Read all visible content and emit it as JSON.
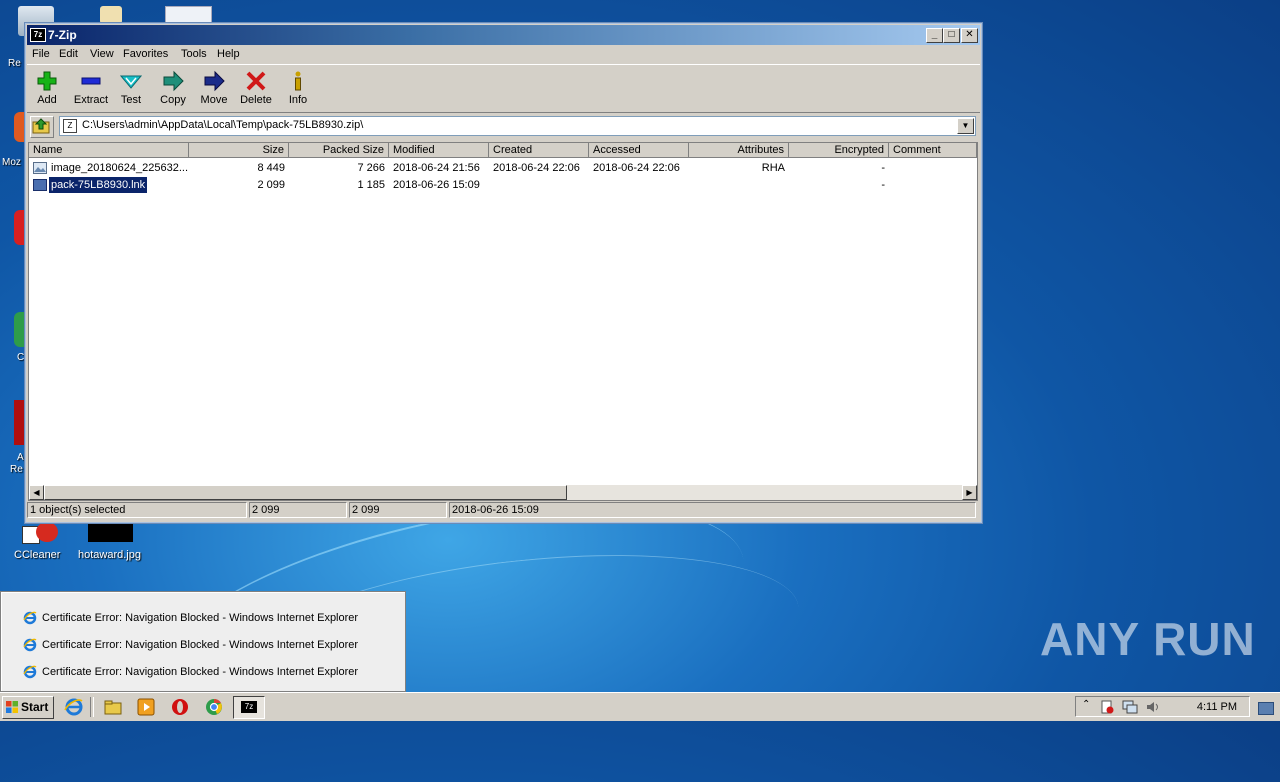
{
  "desktop": {
    "icons": [
      {
        "label": "CCleaner"
      },
      {
        "label": "hotaward.jpg"
      }
    ],
    "partial_labels": [
      "Re",
      "Moz",
      "C",
      "A",
      "Re"
    ]
  },
  "window": {
    "title": "7-Zip",
    "app_icon": "7z",
    "menu": [
      "File",
      "Edit",
      "View",
      "Favorites",
      "Tools",
      "Help"
    ],
    "toolbar": [
      {
        "label": "Add",
        "icon": "plus-icon",
        "color": "#17b317"
      },
      {
        "label": "Extract",
        "icon": "minus-icon",
        "color": "#1e2bd6"
      },
      {
        "label": "Test",
        "icon": "check-icon",
        "color": "#18c0c8"
      },
      {
        "label": "Copy",
        "icon": "arrow-right-icon",
        "color": "#1e8f7a"
      },
      {
        "label": "Move",
        "icon": "arrow-right-icon",
        "color": "#1a2b8a"
      },
      {
        "label": "Delete",
        "icon": "x-icon",
        "color": "#d01818"
      },
      {
        "label": "Info",
        "icon": "info-icon",
        "color": "#c8a000"
      }
    ],
    "address": "C:\\Users\\admin\\AppData\\Local\\Temp\\pack-75LB8930.zip\\",
    "columns": [
      "Name",
      "Size",
      "Packed Size",
      "Modified",
      "Created",
      "Accessed",
      "Attributes",
      "Encrypted",
      "Comment"
    ],
    "rows": [
      {
        "name": "image_20180624_225632...",
        "size": "8 449",
        "packed": "7 266",
        "modified": "2018-06-24 21:56",
        "created": "2018-06-24 22:06",
        "accessed": "2018-06-24 22:06",
        "attributes": "RHA",
        "encrypted": "-",
        "comment": "",
        "selected": false
      },
      {
        "name": "pack-75LB8930.lnk",
        "size": "2 099",
        "packed": "1 185",
        "modified": "2018-06-26 15:09",
        "created": "",
        "accessed": "",
        "attributes": "",
        "encrypted": "-",
        "comment": "",
        "selected": true
      }
    ],
    "status": [
      "1 object(s) selected",
      "2 099",
      "2 099",
      "2018-06-26 15:09"
    ]
  },
  "popup": {
    "items": [
      "Certificate Error: Navigation Blocked - Windows Internet Explorer",
      "Certificate Error: Navigation Blocked - Windows Internet Explorer",
      "Certificate Error: Navigation Blocked - Windows Internet Explorer"
    ]
  },
  "taskbar": {
    "start_label": "Start",
    "clock": "4:11 PM"
  },
  "watermark": "ANY RUN"
}
